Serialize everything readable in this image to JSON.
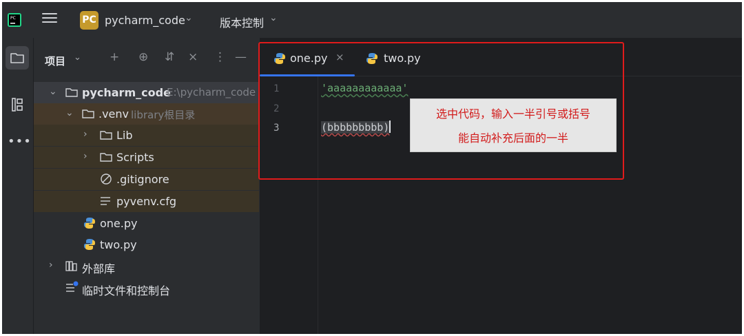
{
  "titlebar": {
    "project_badge": "PC",
    "project_name": "pycharm_code",
    "vcs_label": "版本控制"
  },
  "panel": {
    "title": "项目",
    "tree": [
      {
        "label": "pycharm_code",
        "sub": "E:\\pycharm_code",
        "type": "folder"
      },
      {
        "label": ".venv",
        "sub": "library根目录",
        "type": "folder"
      },
      {
        "label": "Lib",
        "type": "folder"
      },
      {
        "label": "Scripts",
        "type": "folder"
      },
      {
        "label": ".gitignore",
        "type": "ignore-file"
      },
      {
        "label": "pyvenv.cfg",
        "type": "config-file"
      },
      {
        "label": "one.py",
        "type": "python-file"
      },
      {
        "label": "two.py",
        "type": "python-file"
      },
      {
        "label": "外部库",
        "type": "library"
      },
      {
        "label": "临时文件和控制台",
        "type": "scratches"
      }
    ]
  },
  "editor": {
    "tabs": [
      {
        "label": "one.py",
        "active": true
      },
      {
        "label": "two.py",
        "active": false
      }
    ],
    "line_numbers": [
      "1",
      "2",
      "3"
    ],
    "lines": {
      "line1": "'aaaaaaaaaaaa'",
      "line3": "(bbbbbbbbb)"
    }
  },
  "annotation": {
    "line1": "选中代码，输入一半引号或括号",
    "line2": "能自动补充后面的一半",
    "color": "#e01b1b"
  },
  "colors": {
    "accent": "#3574f0",
    "project_badge": "#c59a2c",
    "string": "#6aab73"
  }
}
